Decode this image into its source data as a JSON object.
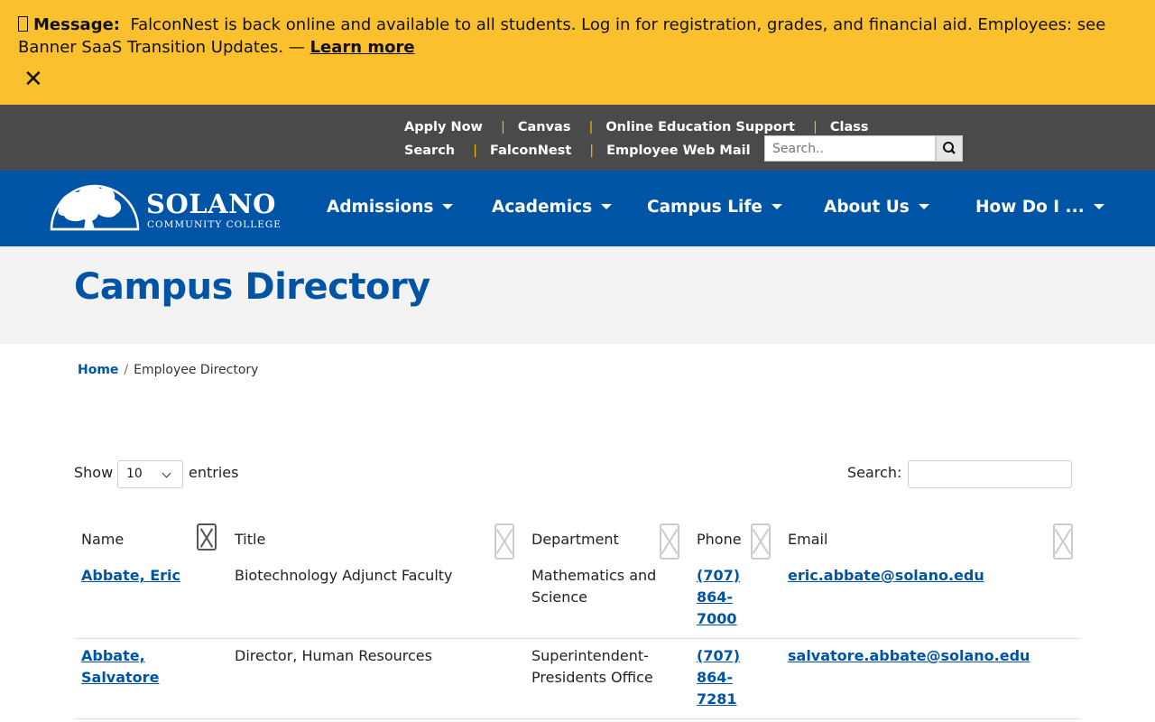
{
  "alert": {
    "prefix": "Message:",
    "text": "FalconNest is back online and available to all students. Log in for registration, grades, and financial aid. Employees: see Banner SaaS Transition Updates. —",
    "link": "Learn more",
    "close_icon": "close-icon"
  },
  "utility": {
    "links": [
      "Apply Now",
      "Canvas",
      "Online Education Support",
      "Class Search",
      "FalconNest",
      "Employee Web Mail"
    ],
    "search_placeholder": "Search..",
    "search_icon": "search-icon"
  },
  "nav": {
    "logo_name": "SOLANO",
    "logo_sub": "COMMUNITY COLLEGE",
    "items": [
      "Admissions",
      "Academics",
      "Campus Life",
      "About Us",
      "How Do I ..."
    ]
  },
  "hero": {
    "title": "Campus Directory"
  },
  "breadcrumb": {
    "home": "Home",
    "current": "Employee Directory"
  },
  "table_controls": {
    "show_label": "Show",
    "page_size": "10",
    "entries_label": "entries",
    "search_label": "Search:"
  },
  "table": {
    "columns": [
      "Name",
      "Title",
      "Department",
      "Phone",
      "Email"
    ],
    "rows": [
      {
        "name": "Abbate, Eric",
        "title": "Biotechnology Adjunct Faculty",
        "department": "Mathematics and Science",
        "phone": "(707) 864-7000",
        "email": "eric.abbate@solano.edu"
      },
      {
        "name": "Abbate, Salvatore",
        "title": "Director, Human Resources",
        "department": "Superintendent-Presidents Office",
        "phone": "(707) 864-7281",
        "email": "salvatore.abbate@solano.edu"
      }
    ]
  },
  "colors": {
    "alert_bg": "#fbc02d",
    "utility_bg": "#4a4a4a",
    "nav_bg": "#0054a6",
    "link": "#0054a6",
    "separator": "#f2b705"
  }
}
